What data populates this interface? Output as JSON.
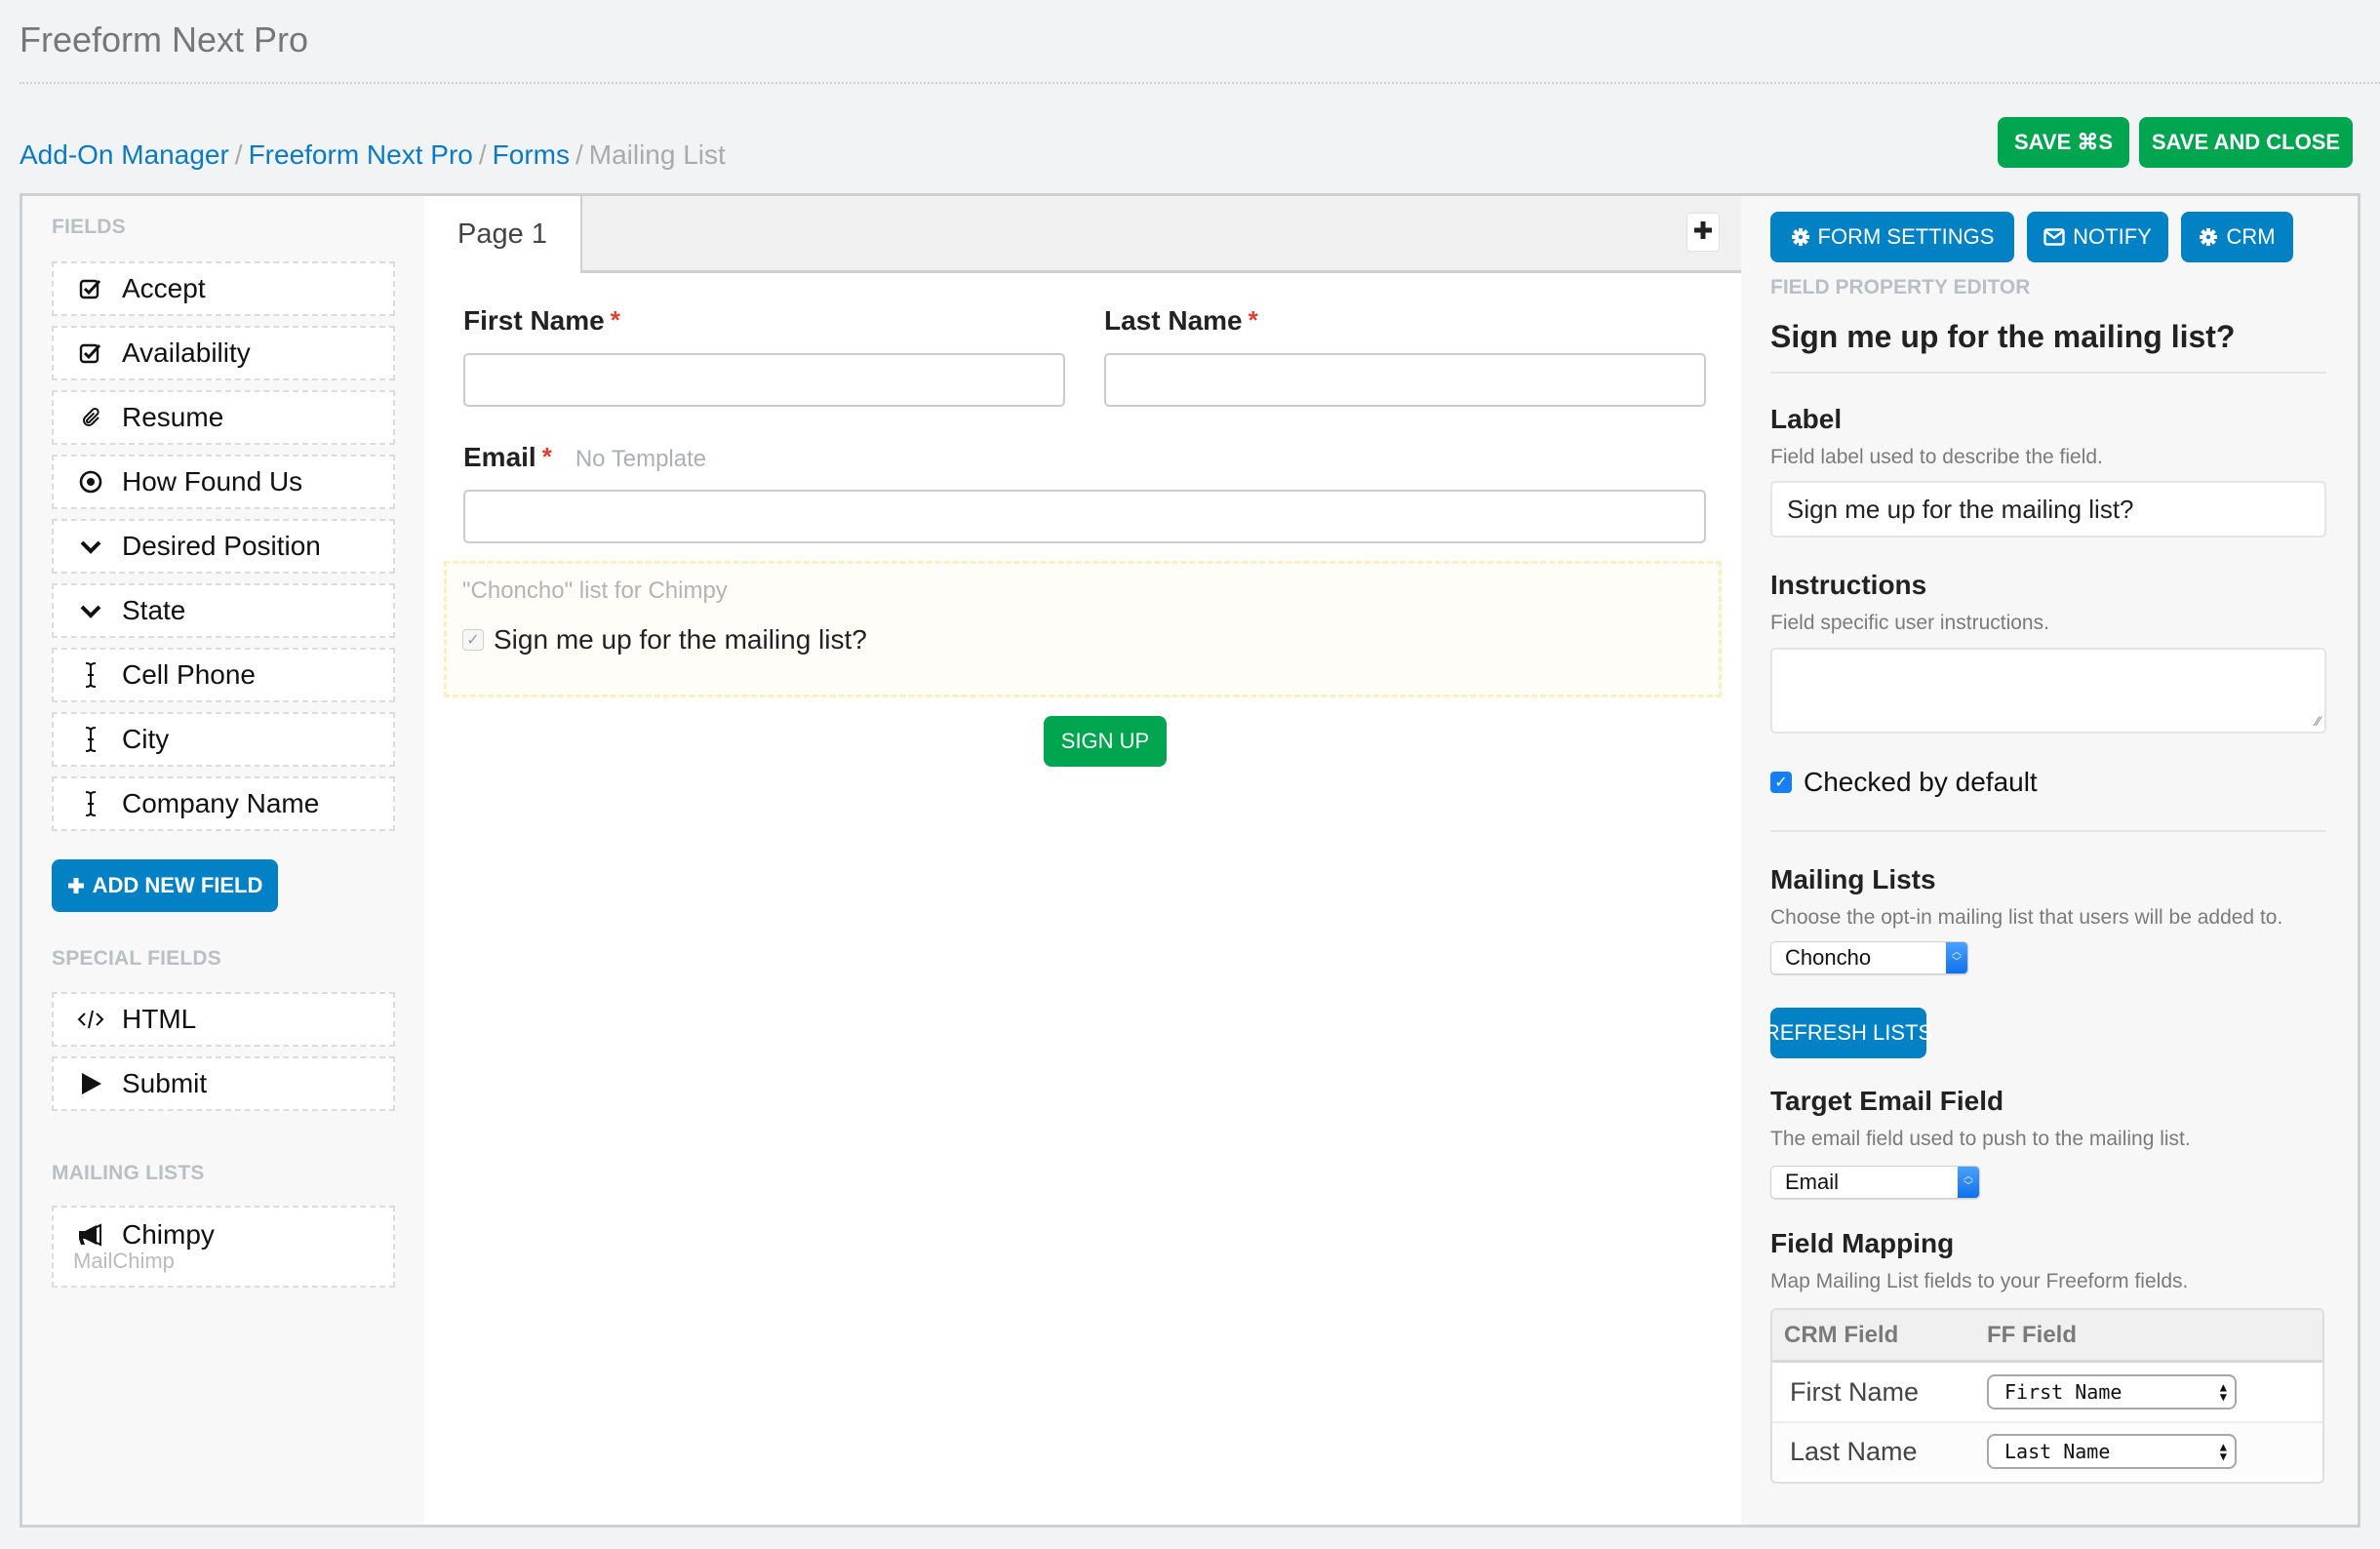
{
  "app_title": "Freeform Next Pro",
  "breadcrumb": {
    "items": [
      "Add-On Manager",
      "Freeform Next Pro",
      "Forms"
    ],
    "current": "Mailing List",
    "separator": "/"
  },
  "toolbar": {
    "save_label": "SAVE ⌘S",
    "save_close_label": "SAVE AND CLOSE"
  },
  "colors": {
    "green": "#00a54f",
    "blue": "#0282c5",
    "link": "#0b7ac2",
    "required": "#e2402e"
  },
  "sidebar": {
    "fields_heading": "FIELDS",
    "fields": [
      {
        "label": "Accept",
        "icon": "checkbox-icon"
      },
      {
        "label": "Availability",
        "icon": "checkbox-icon"
      },
      {
        "label": "Resume",
        "icon": "paperclip-icon"
      },
      {
        "label": "How Found Us",
        "icon": "radio-icon"
      },
      {
        "label": "Desired Position",
        "icon": "chevron-down-icon"
      },
      {
        "label": "State",
        "icon": "chevron-down-icon"
      },
      {
        "label": "Cell Phone",
        "icon": "text-cursor-icon"
      },
      {
        "label": "City",
        "icon": "text-cursor-icon"
      },
      {
        "label": "Company Name",
        "icon": "text-cursor-icon"
      }
    ],
    "add_field_label": "ADD NEW FIELD",
    "special_heading": "SPECIAL FIELDS",
    "special_fields": [
      {
        "label": "HTML",
        "icon": "code-icon"
      },
      {
        "label": "Submit",
        "icon": "play-icon"
      }
    ],
    "mailing_heading": "MAILING LISTS",
    "mailing_lists": [
      {
        "label": "Chimpy",
        "sub": "MailChimp",
        "icon": "megaphone-icon"
      }
    ]
  },
  "builder": {
    "tabs": [
      {
        "label": "Page 1",
        "active": true
      }
    ],
    "add_page_icon": "plus-icon",
    "fields": {
      "first_name": {
        "label": "First Name",
        "required": "*",
        "value": ""
      },
      "last_name": {
        "label": "Last Name",
        "required": "*",
        "value": ""
      },
      "email": {
        "label": "Email",
        "required": "*",
        "note": "No Template",
        "value": ""
      }
    },
    "optin": {
      "caption": "\"Choncho\" list for Chimpy",
      "label": "Sign me up for the mailing list?",
      "checked": true
    },
    "submit_label": "SIGN UP"
  },
  "property_editor": {
    "tabs": [
      {
        "label": "FORM SETTINGS",
        "icon": "gear-icon"
      },
      {
        "label": "NOTIFY",
        "icon": "envelope-icon"
      },
      {
        "label": "CRM",
        "icon": "gear-icon"
      }
    ],
    "section_label": "FIELD PROPERTY EDITOR",
    "field_title": "Sign me up for the mailing list?",
    "label": {
      "title": "Label",
      "help": "Field label used to describe the field.",
      "value": "Sign me up for the mailing list?"
    },
    "instructions": {
      "title": "Instructions",
      "help": "Field specific user instructions.",
      "value": ""
    },
    "checked_by_default": {
      "label": "Checked by default",
      "checked": true
    },
    "mailing_lists": {
      "title": "Mailing Lists",
      "help": "Choose the opt-in mailing list that users will be added to.",
      "selected": "Choncho",
      "refresh_label": "REFRESH LISTS"
    },
    "target_email": {
      "title": "Target Email Field",
      "help": "The email field used to push to the mailing list.",
      "selected": "Email"
    },
    "field_mapping": {
      "title": "Field Mapping",
      "help": "Map Mailing List fields to your Freeform fields.",
      "columns": [
        "CRM Field",
        "FF Field"
      ],
      "rows": [
        {
          "crm": "First Name",
          "ff": "First Name"
        },
        {
          "crm": "Last Name",
          "ff": "Last Name"
        }
      ]
    }
  }
}
